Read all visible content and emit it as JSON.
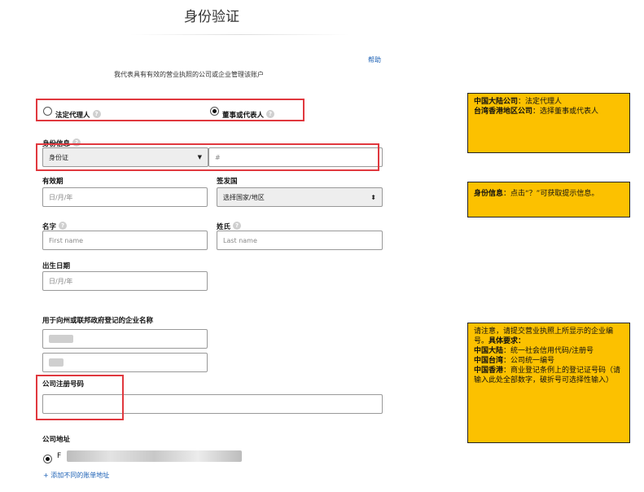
{
  "header": {
    "title": "身份验证",
    "help": "帮助",
    "subtitle": "我代表具有有效的营业执照的公司或企业管理该账户"
  },
  "role": {
    "option1": "法定代理人",
    "option2": "董事或代表人",
    "selected": "董事或代表人"
  },
  "identity": {
    "label": "身份信息",
    "doc_type": "身份证",
    "number_placeholder": "#"
  },
  "validity": {
    "label": "有效期",
    "placeholder": "日/月/年"
  },
  "issuer": {
    "label": "签发国",
    "value": "选择国家/地区"
  },
  "first_name": {
    "label": "名字",
    "placeholder": "First name"
  },
  "last_name": {
    "label": "姓氏",
    "placeholder": "Last name"
  },
  "birth": {
    "label": "出生日期",
    "placeholder": "日/月/年"
  },
  "company_name": {
    "label": "用于向州或联邦政府登记的企业名称"
  },
  "reg_no": {
    "label": "公司注册号码"
  },
  "address": {
    "label": "公司地址",
    "line_prefix": "F",
    "add_link": "+ 添加不同的账单地址"
  },
  "notes": {
    "n1": {
      "b1": "中国大陆公司",
      "t1": "：法定代理人",
      "b2": "台湾香港地区公司",
      "t2": "：选择董事或代表人"
    },
    "n2": {
      "b1": "身份信息",
      "t1": "：点击“？”可获取提示信息。"
    },
    "n3": {
      "intro": "请注意，请提交营业执照上所显示的企业编号。",
      "intro_bold": "具体要求：",
      "b1": "中国大陆",
      "t1": "：统一社会信用代码/注册号",
      "b2": "中国台湾",
      "t2": "：公司统一编号",
      "b3": "中国香港",
      "t3": "：商业登记条例上的登记证号码（请输入此处全部数字，破折号可选择性输入）"
    }
  },
  "colors": {
    "note_bg": "#fcc100",
    "highlight_red": "#e0383e",
    "link": "#1a5fb4"
  }
}
